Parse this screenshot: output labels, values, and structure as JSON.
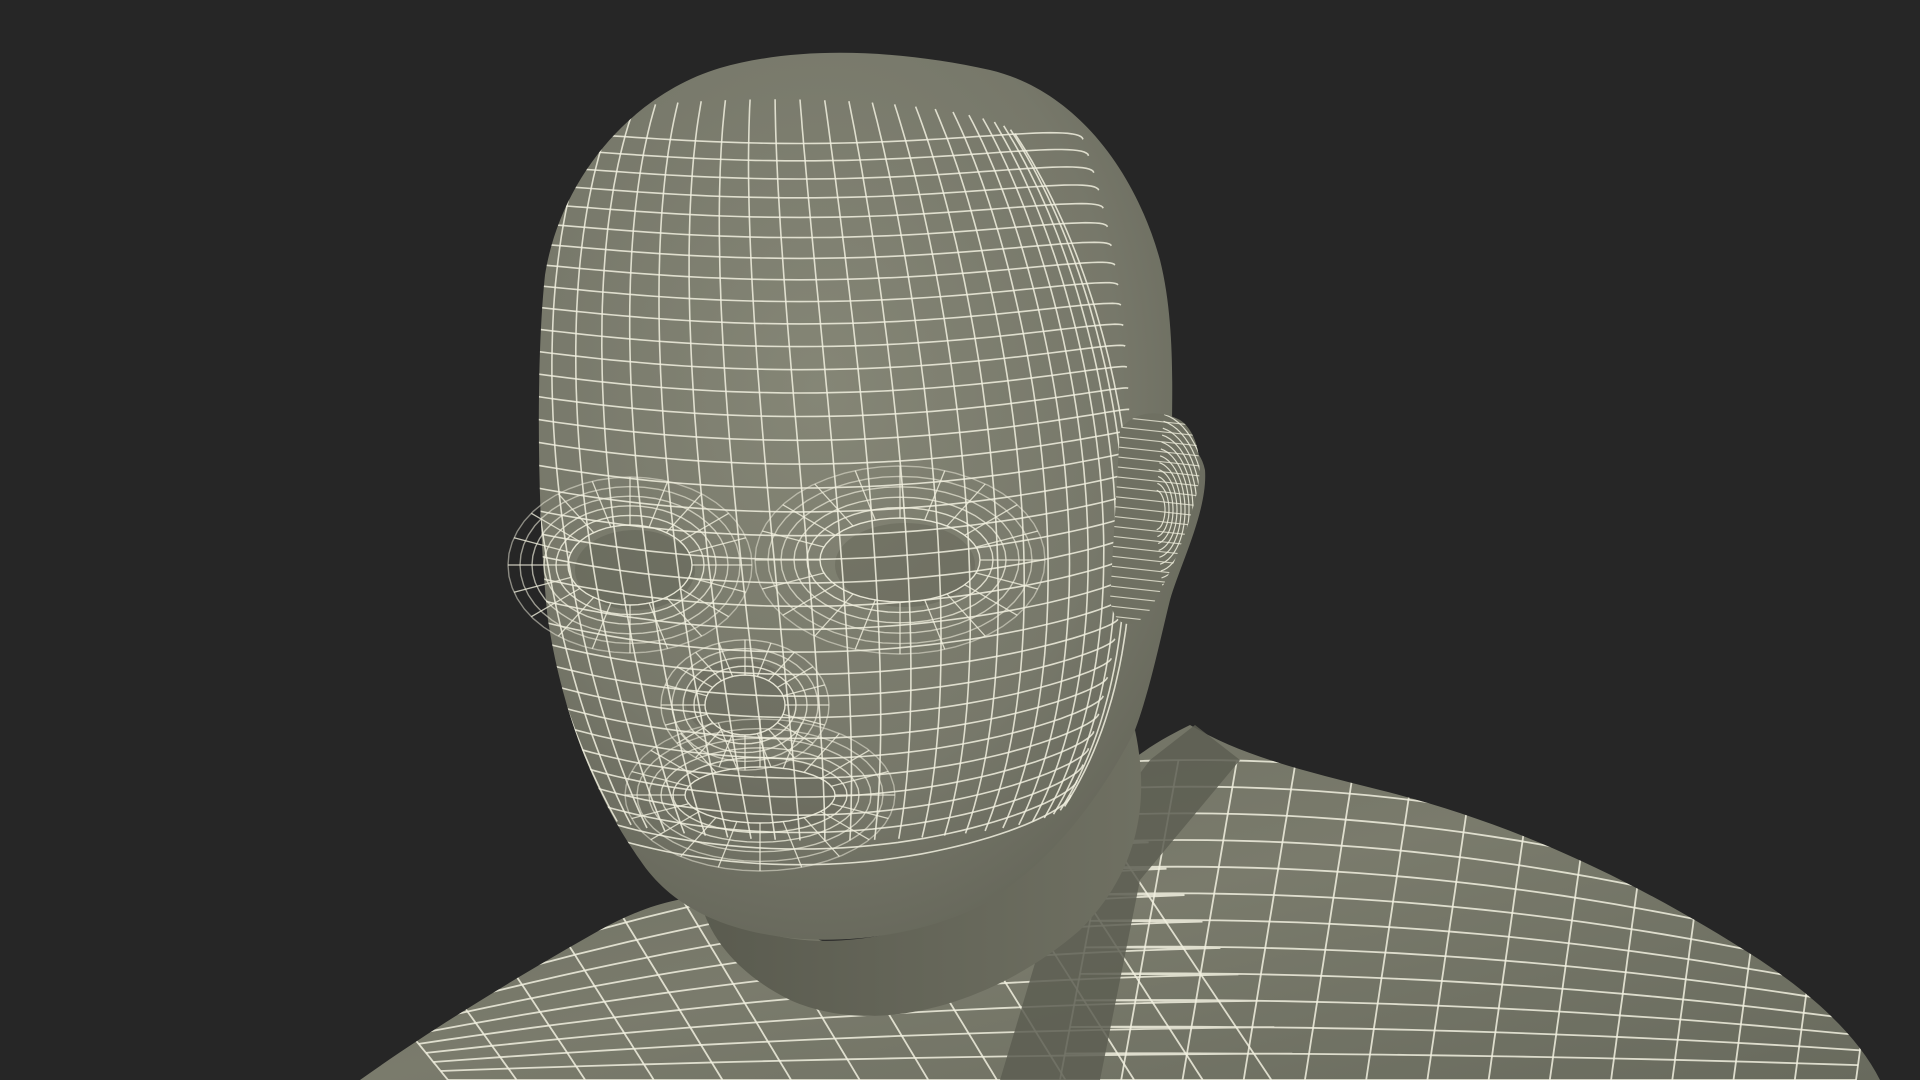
{
  "scene": {
    "subject": "human-bust-wireframe-mesh",
    "colors": {
      "background": "#262626",
      "surface_light": "#7f8070",
      "surface_mid": "#717263",
      "surface_dark": "#5b5c50",
      "wire": "#f1f0df"
    }
  }
}
